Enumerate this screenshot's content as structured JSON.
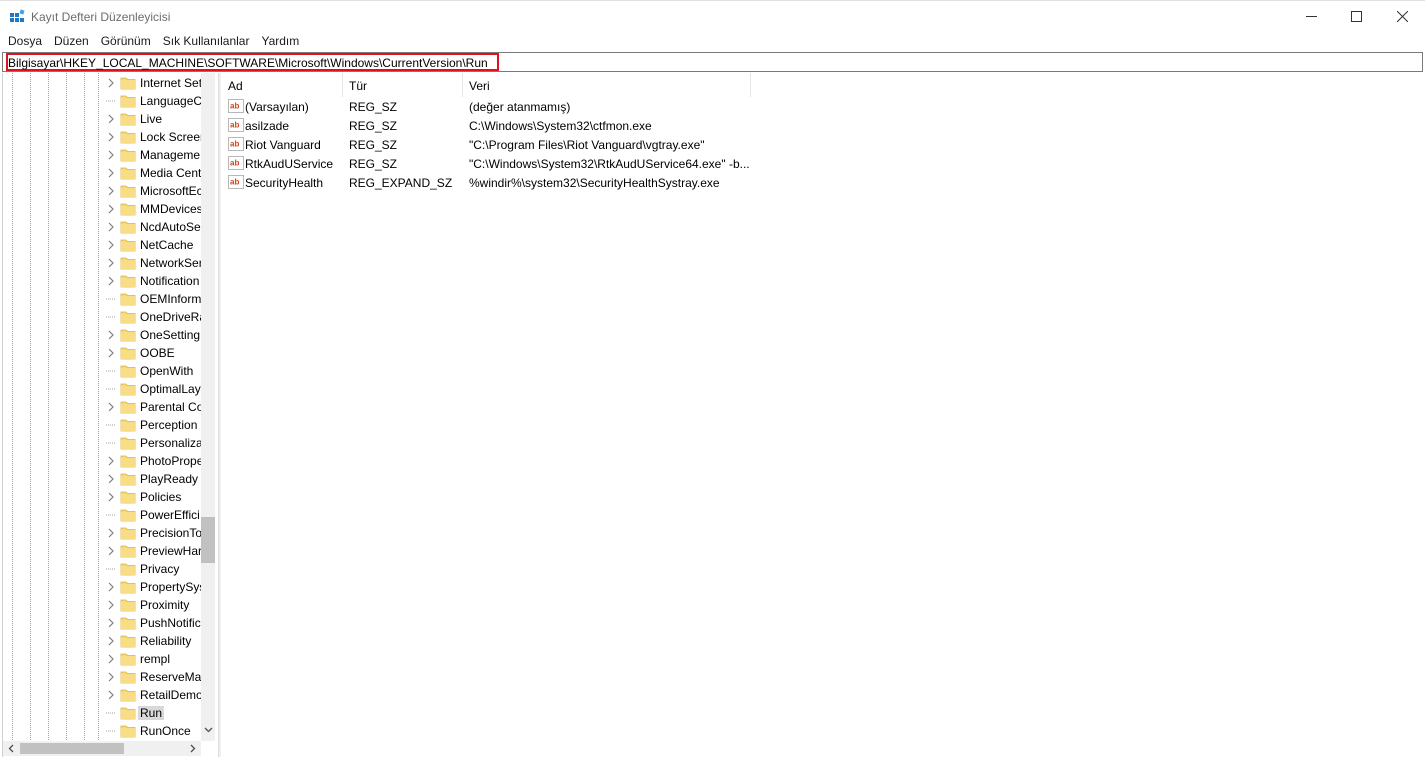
{
  "window": {
    "title": "Kayıt Defteri Düzenleyicisi"
  },
  "menu": [
    "Dosya",
    "Düzen",
    "Görünüm",
    "Sık Kullanılanlar",
    "Yardım"
  ],
  "address": {
    "path": "Bilgisayar\\HKEY_LOCAL_MACHINE\\SOFTWARE\\Microsoft\\Windows\\CurrentVersion\\Run",
    "highlight_color": "#e0101f"
  },
  "tree": {
    "items": [
      {
        "label": "Internet Set",
        "expandable": true
      },
      {
        "label": "LanguageC",
        "expandable": false
      },
      {
        "label": "Live",
        "expandable": true
      },
      {
        "label": "Lock Screer",
        "expandable": true
      },
      {
        "label": "Manageme",
        "expandable": true
      },
      {
        "label": "Media Cent",
        "expandable": true
      },
      {
        "label": "MicrosoftEc",
        "expandable": true
      },
      {
        "label": "MMDevices",
        "expandable": true
      },
      {
        "label": "NcdAutoSe",
        "expandable": true
      },
      {
        "label": "NetCache",
        "expandable": true
      },
      {
        "label": "NetworkSer",
        "expandable": true
      },
      {
        "label": "Notification",
        "expandable": true
      },
      {
        "label": "OEMInform",
        "expandable": false
      },
      {
        "label": "OneDriveRa",
        "expandable": false
      },
      {
        "label": "OneSetting",
        "expandable": true
      },
      {
        "label": "OOBE",
        "expandable": true
      },
      {
        "label": "OpenWith",
        "expandable": false
      },
      {
        "label": "OptimalLay",
        "expandable": false
      },
      {
        "label": "Parental Co",
        "expandable": true
      },
      {
        "label": "Perception",
        "expandable": false
      },
      {
        "label": "Personaliza",
        "expandable": false
      },
      {
        "label": "PhotoPrope",
        "expandable": true
      },
      {
        "label": "PlayReady",
        "expandable": true
      },
      {
        "label": "Policies",
        "expandable": true
      },
      {
        "label": "PowerEffici",
        "expandable": false
      },
      {
        "label": "PrecisionTo",
        "expandable": true
      },
      {
        "label": "PreviewHar",
        "expandable": true
      },
      {
        "label": "Privacy",
        "expandable": false
      },
      {
        "label": "PropertySys",
        "expandable": true
      },
      {
        "label": "Proximity",
        "expandable": true
      },
      {
        "label": "PushNotific",
        "expandable": true
      },
      {
        "label": "Reliability",
        "expandable": true
      },
      {
        "label": "rempl",
        "expandable": true
      },
      {
        "label": "ReserveMar",
        "expandable": true
      },
      {
        "label": "RetailDemo",
        "expandable": true
      },
      {
        "label": "Run",
        "expandable": false,
        "selected": true
      },
      {
        "label": "RunOnce",
        "expandable": false
      }
    ]
  },
  "list": {
    "columns": [
      "Ad",
      "Tür",
      "Veri"
    ],
    "rows": [
      {
        "name": "(Varsayılan)",
        "type": "REG_SZ",
        "data": "(değer atanmamış)"
      },
      {
        "name": "asilzade",
        "type": "REG_SZ",
        "data": "C:\\Windows\\System32\\ctfmon.exe"
      },
      {
        "name": "Riot Vanguard",
        "type": "REG_SZ",
        "data": "\"C:\\Program Files\\Riot Vanguard\\vgtray.exe\""
      },
      {
        "name": "RtkAudUService",
        "type": "REG_SZ",
        "data": "\"C:\\Windows\\System32\\RtkAudUService64.exe\" -b..."
      },
      {
        "name": "SecurityHealth",
        "type": "REG_EXPAND_SZ",
        "data": "%windir%\\system32\\SecurityHealthSystray.exe"
      }
    ]
  },
  "icons": {
    "app": "registry-editor-icon",
    "folder": "folder-icon",
    "value": "string-value-icon",
    "folder_color": "#f5d67a"
  }
}
